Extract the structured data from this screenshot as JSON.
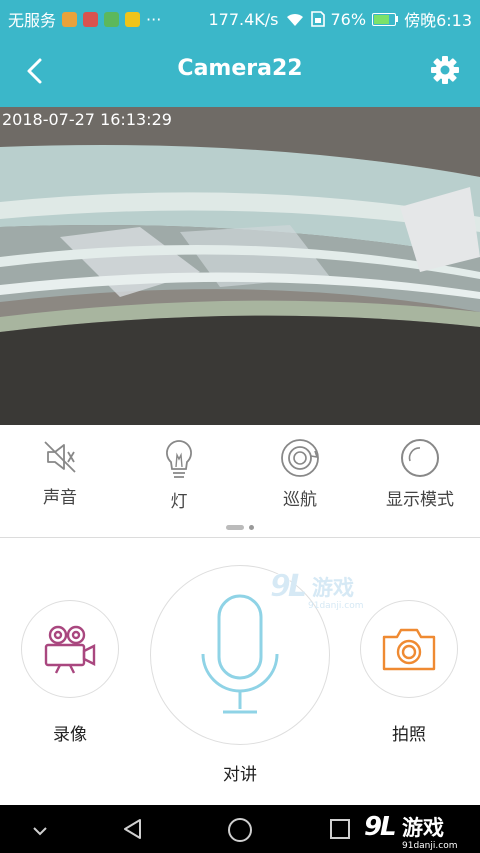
{
  "status_bar": {
    "carrier": "无服务",
    "dots": "···",
    "speed": "177.4K/s",
    "battery": "76%",
    "time": "傍晚6:13",
    "battery_level": 0.76
  },
  "header": {
    "title": "Camera22"
  },
  "camera": {
    "timestamp": "2018-07-27 16:13:29"
  },
  "controls": {
    "sound": "声音",
    "light": "灯",
    "cruise": "巡航",
    "display_mode": "显示模式"
  },
  "actions": {
    "record": "录像",
    "talk": "对讲",
    "photo": "拍照"
  },
  "watermark": {
    "brand_top": "游戏",
    "site": "91danji.com",
    "brand_bottom": "游戏",
    "site_bottom": "91danji.com"
  },
  "colors": {
    "header_bg": "#3bb7c9",
    "record_icon": "#a9477f",
    "mic_icon": "#8fd3e6",
    "photo_icon": "#ef8a32"
  }
}
